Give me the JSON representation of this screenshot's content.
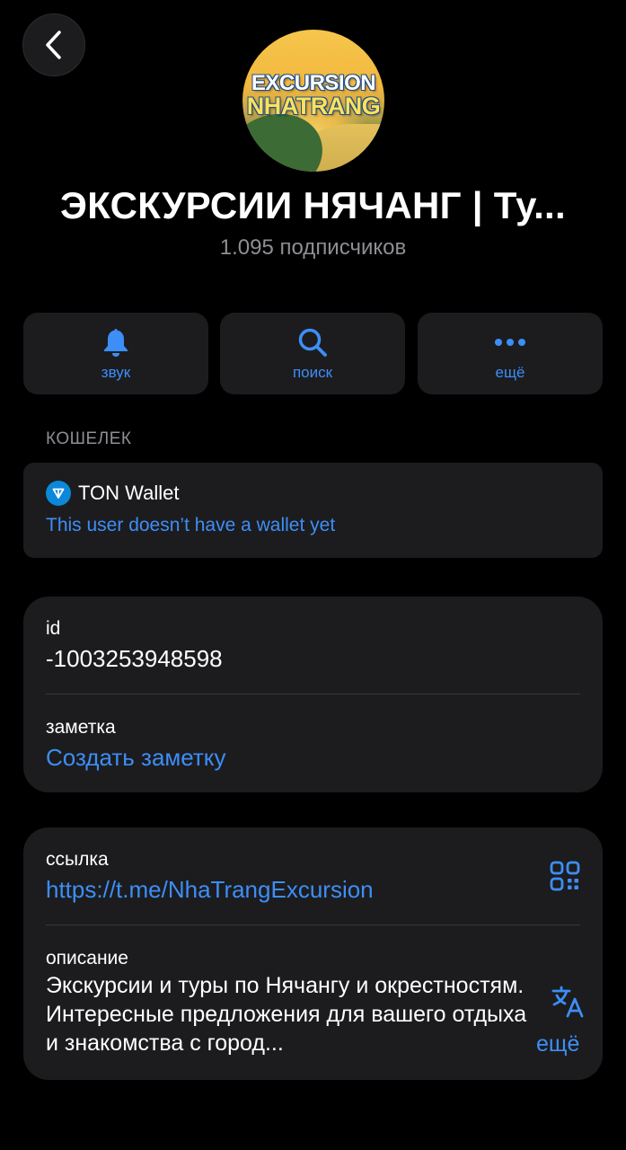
{
  "nav": {
    "back_icon": "chevron-left-icon"
  },
  "channel": {
    "avatar_line1": "EXCURSION",
    "avatar_line2": "NHATRANG",
    "title": "ЭКСКУРСИИ НЯЧАНГ | Ту...",
    "subscribers": "1.095 подписчиков"
  },
  "actions": [
    {
      "label": "звук",
      "icon": "bell-icon"
    },
    {
      "label": "поиск",
      "icon": "search-icon"
    },
    {
      "label": "ещё",
      "icon": "more-dots-icon"
    }
  ],
  "wallet": {
    "section_header": "КОШЕЛЕК",
    "name": "TON Wallet",
    "status": "This user doesn’t have a wallet yet"
  },
  "info": {
    "id_label": "id",
    "id_value": "-1003253948598",
    "note_label": "заметка",
    "note_action": "Создать заметку"
  },
  "link": {
    "label": "ссылка",
    "url": "https://t.me/NhaTrangExcursion",
    "qr_icon": "qr-code-icon"
  },
  "description": {
    "label": "описание",
    "text": "Экскурсии и туры по Нячангу и окрестностям. Интересные предложения для вашего отдыха и знакомства с город...",
    "more": "ещё",
    "translate_icon": "translate-icon"
  },
  "colors": {
    "background": "#000000",
    "card": "#1c1c1e",
    "accent": "#3d8ef7",
    "secondary_text": "#8e8e93",
    "ton": "#0b88d9"
  }
}
